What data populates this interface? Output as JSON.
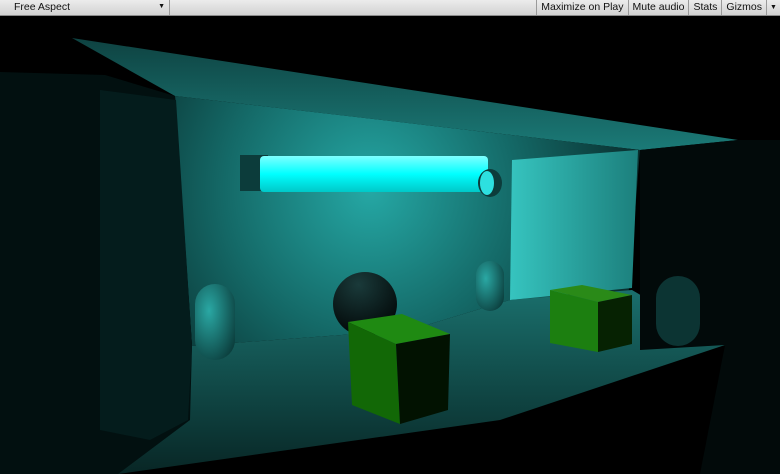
{
  "toolbar": {
    "aspect": "Free Aspect",
    "maximize_on_play": "Maximize on Play",
    "mute_audio": "Mute audio",
    "stats": "Stats",
    "gizmos": "Gizmos"
  },
  "colors": {
    "light": "#00ffff",
    "ambient": "#1a8a88",
    "cube": "#1c7f10"
  },
  "icons": {
    "dropdown": "chevron-down-icon"
  }
}
